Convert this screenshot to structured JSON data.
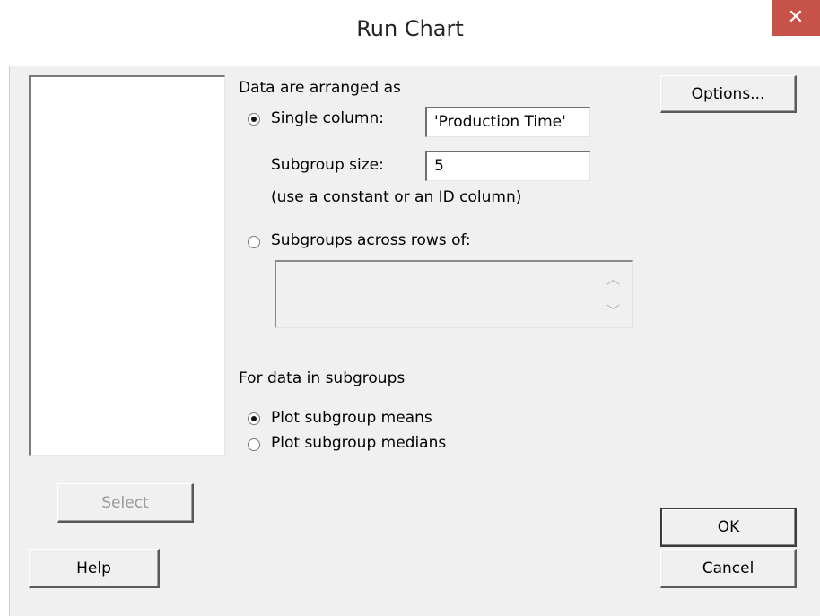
{
  "window": {
    "title": "Run Chart",
    "close_glyph": "✕"
  },
  "arrangement": {
    "heading": "Data are arranged as",
    "single_column_label": "Single column:",
    "single_column_value": "'Production Time'",
    "subgroup_size_label": "Subgroup size:",
    "subgroup_size_value": "5",
    "hint": "(use a constant or an ID column)",
    "across_rows_label": "Subgroups across rows of:",
    "across_rows_value": "",
    "selected": "single_column"
  },
  "subgroups": {
    "heading": "For data in subgroups",
    "means_label": "Plot subgroup means",
    "medians_label": "Plot subgroup medians",
    "selected": "means"
  },
  "buttons": {
    "options": "Options...",
    "select": "Select",
    "help": "Help",
    "ok": "OK",
    "cancel": "Cancel"
  },
  "icons": {
    "scroll_up": "chevron-up-icon",
    "scroll_down": "chevron-down-icon"
  }
}
